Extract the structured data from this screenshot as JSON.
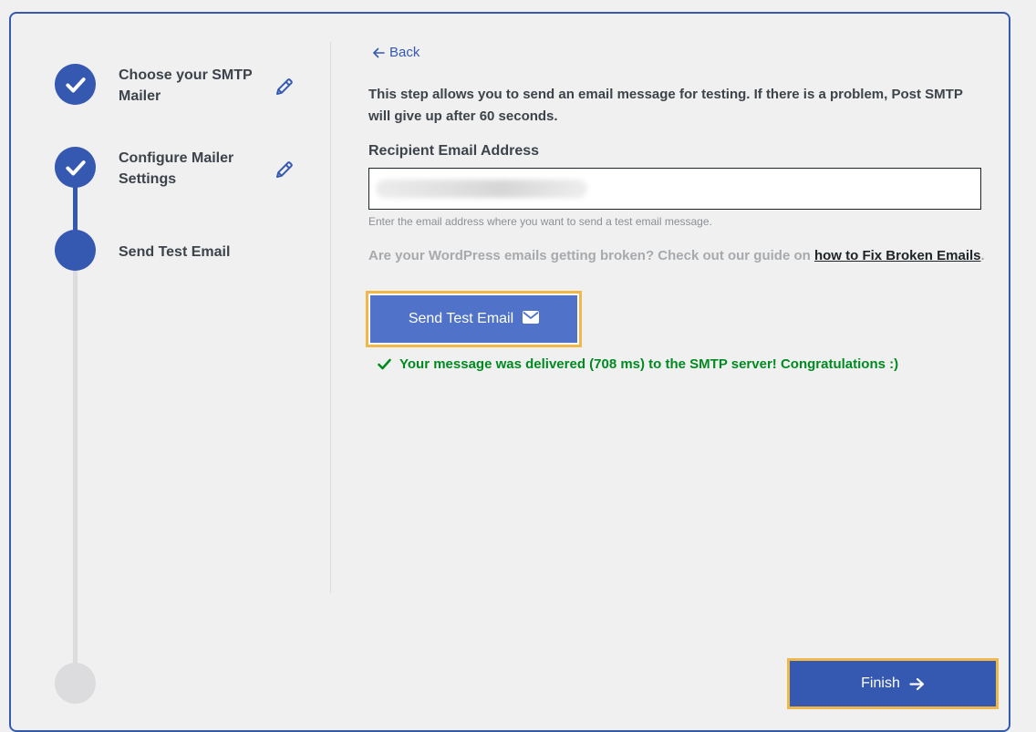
{
  "steps": [
    {
      "label": "Choose your SMTP Mailer",
      "status": "completed",
      "editable": true
    },
    {
      "label": "Configure Mailer Settings",
      "status": "completed",
      "editable": true
    },
    {
      "label": "Send Test Email",
      "status": "current",
      "editable": false
    },
    {
      "label": "",
      "status": "pending",
      "editable": false
    }
  ],
  "main": {
    "back_label": "Back",
    "intro": "This step allows you to send an email message for testing. If there is a problem, Post SMTP will give up after 60 seconds.",
    "recipient_label": "Recipient Email Address",
    "recipient_value": "",
    "recipient_hint": "Enter the email address where you want to send a test email message.",
    "guide_text": "Are your WordPress emails getting broken? Check out our guide on ",
    "guide_link": "how to Fix Broken Emails",
    "guide_suffix": ".",
    "send_button": "Send Test Email",
    "success_message": "Your message was delivered (708 ms) to the SMTP server! Congratulations :)"
  },
  "footer": {
    "finish_button": "Finish"
  },
  "icons": {
    "step_done": "check-icon",
    "edit": "pencil-icon",
    "back": "arrow-left-icon",
    "send": "envelope-icon",
    "success": "check-icon",
    "finish": "arrow-right-icon"
  },
  "colors": {
    "accent": "#3558b1",
    "button": "#5072c8",
    "focus_ring": "#f0b849",
    "success": "#008a20",
    "track_pending": "#dcdcde"
  }
}
